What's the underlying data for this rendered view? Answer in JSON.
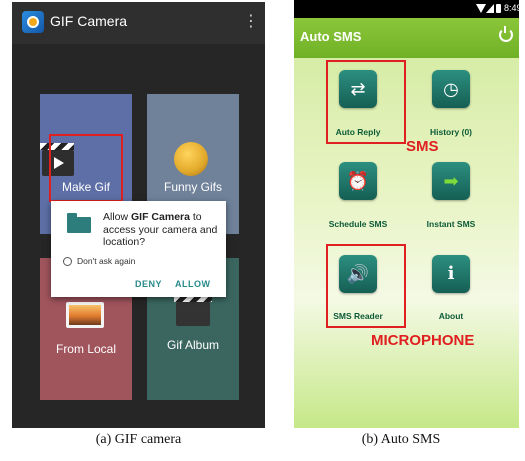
{
  "gif_camera": {
    "app_title": "GIF Camera",
    "menu_glyph": "⋮",
    "tiles": {
      "make_gif": "Make Gif",
      "funny_gifs": "Funny Gifs",
      "from_local": "From Local",
      "gif_album": "Gif Album"
    },
    "dialog": {
      "text_prefix": "Allow ",
      "app_name": "GIF Camera",
      "text_suffix": " to access your camera and location?",
      "checkbox_label": "Don't ask again",
      "deny": "DENY",
      "allow": "ALLOW"
    },
    "caption": "(a)  GIF camera"
  },
  "auto_sms": {
    "status_time": "8:49",
    "app_title": "Auto SMS",
    "items": {
      "auto_reply": "Auto Reply",
      "history": "History (0)",
      "schedule": "Schedule SMS",
      "instant": "Instant SMS",
      "reader": "SMS Reader",
      "about": "About"
    },
    "annotations": {
      "sms": "SMS",
      "microphone": "MICROPHONE"
    },
    "caption": "(b)  Auto SMS"
  },
  "colors": {
    "highlight": "#e02020",
    "sms_header": "#7cbc30",
    "dialog_button": "#2a8a8a"
  }
}
